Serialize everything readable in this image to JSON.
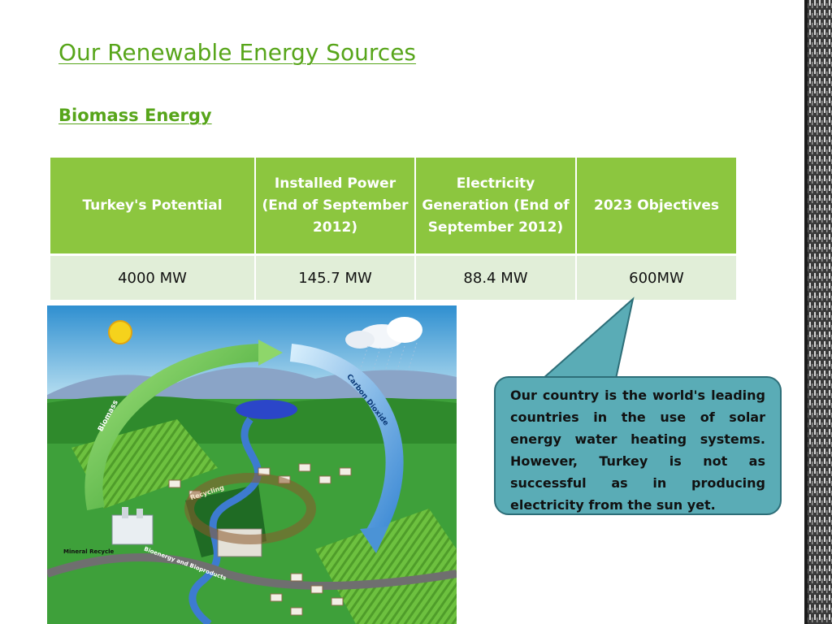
{
  "slide": {
    "title": "Our Renewable Energy Sources",
    "subtitle": "Biomass Energy"
  },
  "table": {
    "headers": [
      "Turkey's Potential",
      "Installed Power (End of September 2012)",
      "Electricity Generation (End of September 2012)",
      "2023 Objectives"
    ],
    "rows": [
      [
        "4000 MW",
        "145.7 MW",
        "88.4 MW",
        "600MW"
      ]
    ]
  },
  "illustration": {
    "labels": {
      "biomass": "Biomass",
      "carbon_dioxide": "Carbon Dioxide",
      "recycling": "Recycling",
      "mineral_recycle": "Mineral Recycle",
      "bioenergy": "Bioenergy and Bioproducts"
    }
  },
  "callout": {
    "text": "Our country is the world's leading countries in the use of solar energy water heating systems. However, Turkey is not as successful as in producing electricity from the sun yet."
  },
  "colors": {
    "accent_green": "#57a51a",
    "header_green": "#8cc63f",
    "row_bg": "#e1eed8",
    "callout_teal": "#5aacb6",
    "callout_border": "#2d6e78"
  }
}
